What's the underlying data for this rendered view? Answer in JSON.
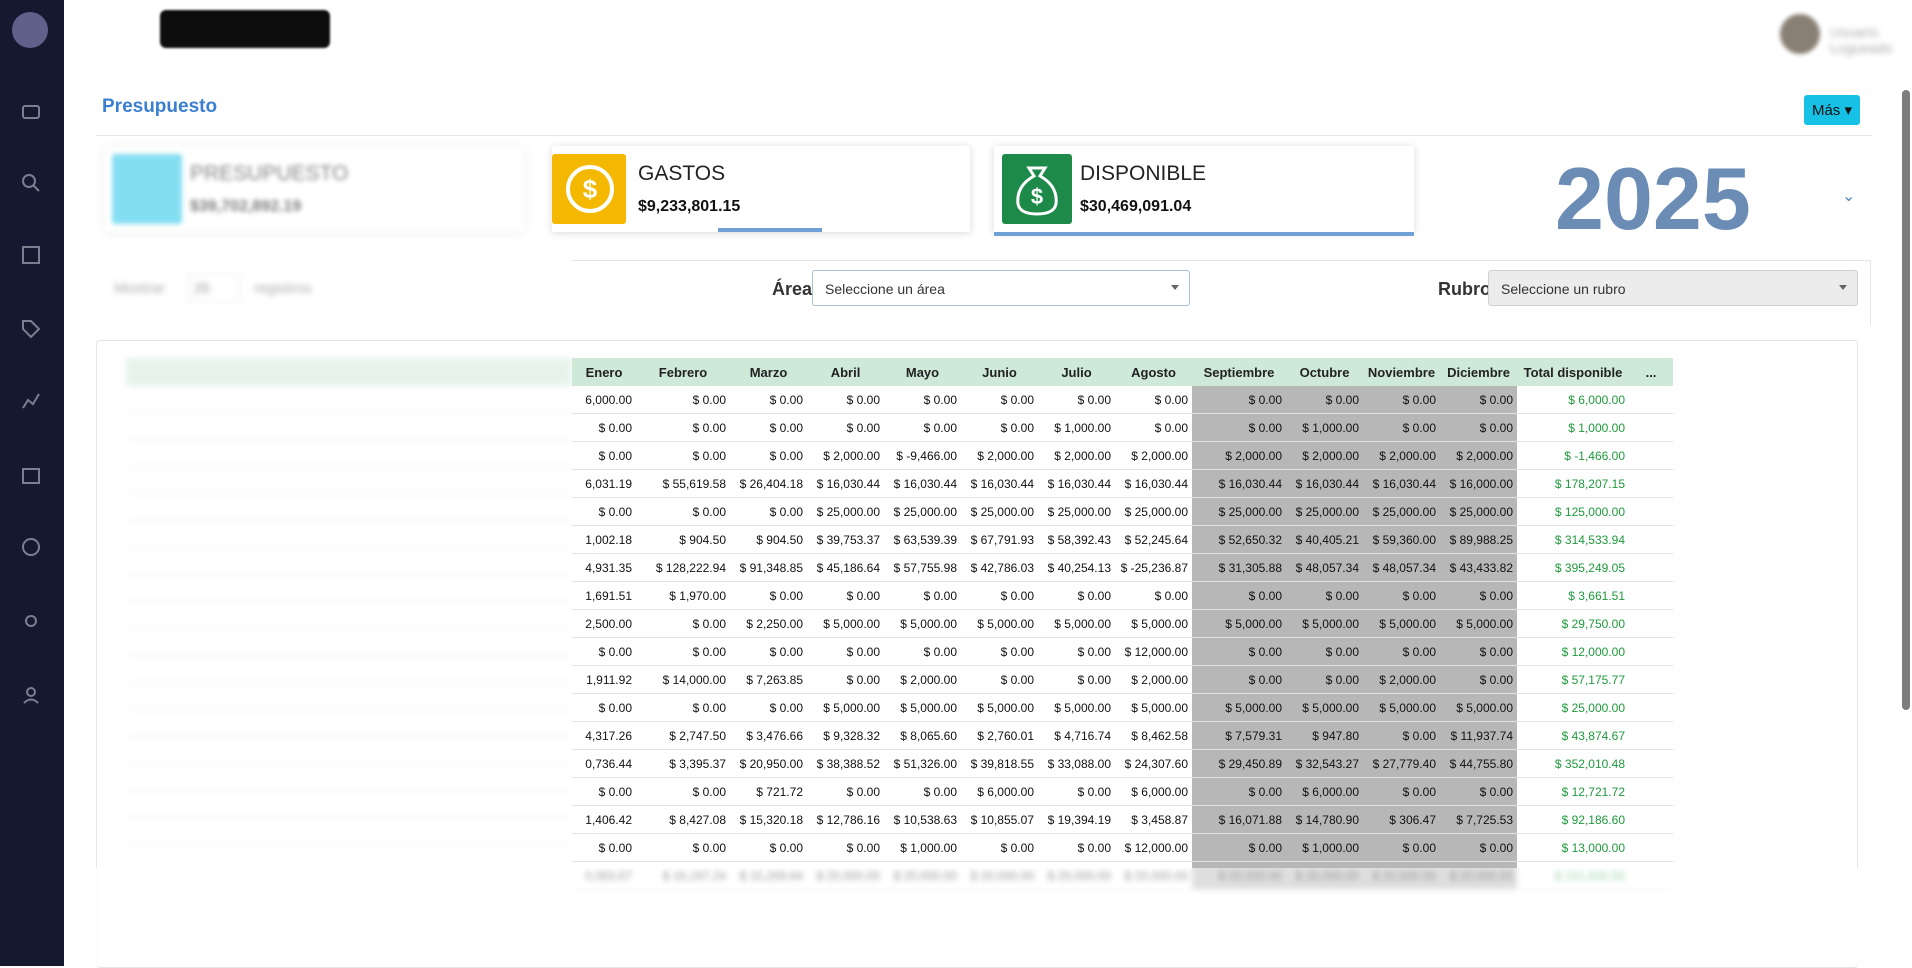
{
  "header": {
    "title": "Presupuesto",
    "more_button": "Más",
    "user_name": "Usuario Logueado"
  },
  "cards": [
    {
      "label": "PRESUPUESTO",
      "value": "$39,702,892.19",
      "color": "#20c4e8",
      "icon": "wallet-icon"
    },
    {
      "label": "GASTOS",
      "value": "$9,233,801.15",
      "color": "#f5b800",
      "icon": "exchange-dollar-icon"
    },
    {
      "label": "DISPONIBLE",
      "value": "$30,469,091.04",
      "color": "#1e8a4a",
      "icon": "money-bag-icon"
    }
  ],
  "year": "2025",
  "filters": {
    "area_label": "Área",
    "area_placeholder": "Seleccione un área",
    "rubro_label": "Rubro",
    "rubro_placeholder": "Seleccione un rubro",
    "show_label": "Mostrar",
    "show_value": "25",
    "records_label": "registros"
  },
  "table": {
    "columns": [
      "Enero",
      "Febrero",
      "Marzo",
      "Abril",
      "Mayo",
      "Junio",
      "Julio",
      "Agosto",
      "Septiembre",
      "Octubre",
      "Noviembre",
      "Diciembre",
      "Total disponible",
      "..."
    ],
    "rows": [
      [
        "6,000.00",
        "$ 0.00",
        "$ 0.00",
        "$ 0.00",
        "$ 0.00",
        "$ 0.00",
        "$ 0.00",
        "$ 0.00",
        "$ 0.00",
        "$ 0.00",
        "$ 0.00",
        "$ 0.00",
        "$ 6,000.00"
      ],
      [
        "$ 0.00",
        "$ 0.00",
        "$ 0.00",
        "$ 0.00",
        "$ 0.00",
        "$ 0.00",
        "$ 1,000.00",
        "$ 0.00",
        "$ 0.00",
        "$ 1,000.00",
        "$ 0.00",
        "$ 0.00",
        "$ 1,000.00"
      ],
      [
        "$ 0.00",
        "$ 0.00",
        "$ 0.00",
        "$ 2,000.00",
        "$ -9,466.00",
        "$ 2,000.00",
        "$ 2,000.00",
        "$ 2,000.00",
        "$ 2,000.00",
        "$ 2,000.00",
        "$ 2,000.00",
        "$ 2,000.00",
        "$ -1,466.00"
      ],
      [
        "6,031.19",
        "$ 55,619.58",
        "$ 26,404.18",
        "$ 16,030.44",
        "$ 16,030.44",
        "$ 16,030.44",
        "$ 16,030.44",
        "$ 16,030.44",
        "$ 16,030.44",
        "$ 16,030.44",
        "$ 16,030.44",
        "$ 16,000.00",
        "$ 178,207.15"
      ],
      [
        "$ 0.00",
        "$ 0.00",
        "$ 0.00",
        "$ 25,000.00",
        "$ 25,000.00",
        "$ 25,000.00",
        "$ 25,000.00",
        "$ 25,000.00",
        "$ 25,000.00",
        "$ 25,000.00",
        "$ 25,000.00",
        "$ 25,000.00",
        "$ 125,000.00"
      ],
      [
        "1,002.18",
        "$ 904.50",
        "$ 904.50",
        "$ 39,753.37",
        "$ 63,539.39",
        "$ 67,791.93",
        "$ 58,392.43",
        "$ 52,245.64",
        "$ 52,650.32",
        "$ 40,405.21",
        "$ 59,360.00",
        "$ 89,988.25",
        "$ 314,533.94"
      ],
      [
        "4,931.35",
        "$ 128,222.94",
        "$ 91,348.85",
        "$ 45,186.64",
        "$ 57,755.98",
        "$ 42,786.03",
        "$ 40,254.13",
        "$ -25,236.87",
        "$ 31,305.88",
        "$ 48,057.34",
        "$ 48,057.34",
        "$ 43,433.82",
        "$ 395,249.05"
      ],
      [
        "1,691.51",
        "$ 1,970.00",
        "$ 0.00",
        "$ 0.00",
        "$ 0.00",
        "$ 0.00",
        "$ 0.00",
        "$ 0.00",
        "$ 0.00",
        "$ 0.00",
        "$ 0.00",
        "$ 0.00",
        "$ 3,661.51"
      ],
      [
        "2,500.00",
        "$ 0.00",
        "$ 2,250.00",
        "$ 5,000.00",
        "$ 5,000.00",
        "$ 5,000.00",
        "$ 5,000.00",
        "$ 5,000.00",
        "$ 5,000.00",
        "$ 5,000.00",
        "$ 5,000.00",
        "$ 5,000.00",
        "$ 29,750.00"
      ],
      [
        "$ 0.00",
        "$ 0.00",
        "$ 0.00",
        "$ 0.00",
        "$ 0.00",
        "$ 0.00",
        "$ 0.00",
        "$ 12,000.00",
        "$ 0.00",
        "$ 0.00",
        "$ 0.00",
        "$ 0.00",
        "$ 12,000.00"
      ],
      [
        "1,911.92",
        "$ 14,000.00",
        "$ 7,263.85",
        "$ 0.00",
        "$ 2,000.00",
        "$ 0.00",
        "$ 0.00",
        "$ 2,000.00",
        "$ 0.00",
        "$ 0.00",
        "$ 2,000.00",
        "$ 0.00",
        "$ 57,175.77"
      ],
      [
        "$ 0.00",
        "$ 0.00",
        "$ 0.00",
        "$ 5,000.00",
        "$ 5,000.00",
        "$ 5,000.00",
        "$ 5,000.00",
        "$ 5,000.00",
        "$ 5,000.00",
        "$ 5,000.00",
        "$ 5,000.00",
        "$ 5,000.00",
        "$ 25,000.00"
      ],
      [
        "4,317.26",
        "$ 2,747.50",
        "$ 3,476.66",
        "$ 9,328.32",
        "$ 8,065.60",
        "$ 2,760.01",
        "$ 4,716.74",
        "$ 8,462.58",
        "$ 7,579.31",
        "$ 947.80",
        "$ 0.00",
        "$ 11,937.74",
        "$ 43,874.67"
      ],
      [
        "0,736.44",
        "$ 3,395.37",
        "$ 20,950.00",
        "$ 38,388.52",
        "$ 51,326.00",
        "$ 39,818.55",
        "$ 33,088.00",
        "$ 24,307.60",
        "$ 29,450.89",
        "$ 32,543.27",
        "$ 27,779.40",
        "$ 44,755.80",
        "$ 352,010.48"
      ],
      [
        "$ 0.00",
        "$ 0.00",
        "$ 721.72",
        "$ 0.00",
        "$ 0.00",
        "$ 6,000.00",
        "$ 0.00",
        "$ 6,000.00",
        "$ 0.00",
        "$ 6,000.00",
        "$ 0.00",
        "$ 0.00",
        "$ 12,721.72"
      ],
      [
        "1,406.42",
        "$ 8,427.08",
        "$ 15,320.18",
        "$ 12,786.16",
        "$ 10,538.63",
        "$ 10,855.07",
        "$ 19,394.19",
        "$ 3,458.87",
        "$ 16,071.88",
        "$ 14,780.90",
        "$ 306.47",
        "$ 7,725.53",
        "$ 92,186.60"
      ],
      [
        "$ 0.00",
        "$ 0.00",
        "$ 0.00",
        "$ 0.00",
        "$ 1,000.00",
        "$ 0.00",
        "$ 0.00",
        "$ 12,000.00",
        "$ 0.00",
        "$ 1,000.00",
        "$ 0.00",
        "$ 0.00",
        "$ 13,000.00"
      ],
      [
        "0,363.67",
        "$ 16,197.24",
        "$ 15,269.64",
        "$ 20,000.00",
        "$ 20,000.00",
        "$ 20,000.00",
        "$ 20,000.00",
        "$ 20,000.00",
        "$ 20,000.00",
        "$ 20,000.00",
        "$ 20,000.00",
        "$ 20,000.00",
        "$ 151,830.55"
      ]
    ]
  },
  "colors": {
    "accent": "#3a7fd0",
    "sidebar": "#15192f",
    "header_row": "#cfe9d9",
    "shaded_cell": "#b7b7b7",
    "total": "#1e9a3c"
  }
}
